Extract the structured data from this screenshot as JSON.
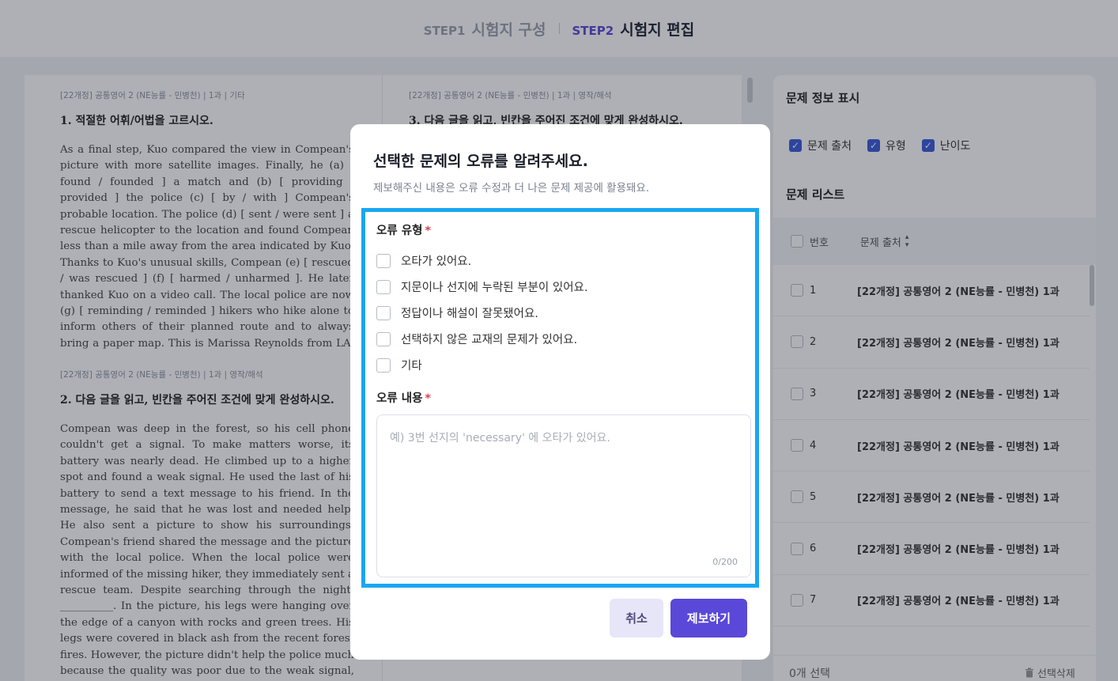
{
  "steps": [
    {
      "num": "STEP1",
      "title": "시험지 구성"
    },
    {
      "num": "STEP2",
      "title": "시험지 편집"
    }
  ],
  "paper": {
    "q1": {
      "meta": "[22개정] 공통영어 2 (NE능률 - 민병천) | 1과 | 기타",
      "title": "1. 적절한 어휘/어법을 고르시오.",
      "body": "As a final step, Kuo compared the view in Compean's picture with more satellite images. Finally, he (a) [ found / founded ] a match and (b) [ providing / provided ] the police (c) [ by / with ] Compean's probable location. The police (d) [ sent / were sent ] a rescue helicopter to the location and found Compean less than a mile away from the area indicated by Kuo. Thanks to Kuo's unusual skills, Compean (e) [ rescued / was rescued ] (f) [ harmed / unharmed ]. He later thanked Kuo on a video call. The local police are now (g) [ reminding / reminded ] hikers who hike alone to inform others of their planned route and to always bring a paper map. This is Marissa Reynolds from LA. Now back to the studio."
    },
    "q2": {
      "meta": "[22개정] 공통영어 2 (NE능률 - 민병천) | 1과 | 영작/해석",
      "title": "2. 다음 글을 읽고, 빈칸을 주어진 조건에 맞게 완성하시오.",
      "body": "Compean was deep in the forest, so his cell phone couldn't get a signal. To make matters worse, its battery was nearly dead. He climbed up to a higher spot and found a weak signal. He used the last of his battery to send a text message to his friend. In the message, he said that he was lost and needed help. He also sent a picture to show his surroundings. Compean's friend shared the message and the picture with the local police. When the local police were informed of the missing hiker, they immediately sent a rescue team. Despite searching through the night, __________. In the picture, his legs were hanging over the edge of a canyon with rocks and green trees. His legs were covered in black ash from the recent forest fires. However, the picture didn't help the police much because the quality was poor due to the weak signal, and his location settings were turned off."
    },
    "q3": {
      "meta": "[22개정] 공통영어 2 (NE능률 - 민병천) | 1과 | 영작/해석",
      "title": "3. 다음 글을 읽고, 빈칸을 주어진 조건에 맞게 완성하시오."
    }
  },
  "right_panel": {
    "info_title": "문제 정보 표시",
    "info_checks": [
      "문제 출처",
      "유형",
      "난이도"
    ],
    "list_title": "문제 리스트",
    "col_no": "번호",
    "col_source": "문제 출처",
    "rows": [
      {
        "no": "1",
        "source": "[22개정] 공통영어 2 (NE능률 - 민병천)  1과"
      },
      {
        "no": "2",
        "source": "[22개정] 공통영어 2 (NE능률 - 민병천)  1과"
      },
      {
        "no": "3",
        "source": "[22개정] 공통영어 2 (NE능률 - 민병천)  1과"
      },
      {
        "no": "4",
        "source": "[22개정] 공통영어 2 (NE능률 - 민병천)  1과"
      },
      {
        "no": "5",
        "source": "[22개정] 공통영어 2 (NE능률 - 민병천)  1과"
      },
      {
        "no": "6",
        "source": "[22개정] 공통영어 2 (NE능률 - 민병천)  1과"
      },
      {
        "no": "7",
        "source": "[22개정] 공통영어 2 (NE능률 - 민병천)  1과"
      }
    ],
    "selected_count": "0개 선택",
    "delete_label": "선택삭제"
  },
  "modal": {
    "title": "선택한 문제의 오류를 알려주세요.",
    "subtitle": "제보해주신 내용은 오류 수정과 더 나은 문제 제공에 활용돼요.",
    "type_label": "오류 유형",
    "required_mark": "*",
    "options": [
      "오타가 있어요.",
      "지문이나 선지에 누락된 부분이 있어요.",
      "정답이나 해설이 잘못됐어요.",
      "선택하지 않은 교재의 문제가 있어요.",
      "기타"
    ],
    "content_label": "오류 내용",
    "content_placeholder": "예) 3번 선지의 'necessary' 에 오타가 있어요.",
    "content_value": "",
    "counter": "0/200",
    "cancel_label": "취소",
    "submit_label": "제보하기"
  },
  "colors": {
    "accent": "#5a48d8",
    "highlight_border": "#1aa7f0",
    "checkbox_checked": "#3b5bdb"
  }
}
